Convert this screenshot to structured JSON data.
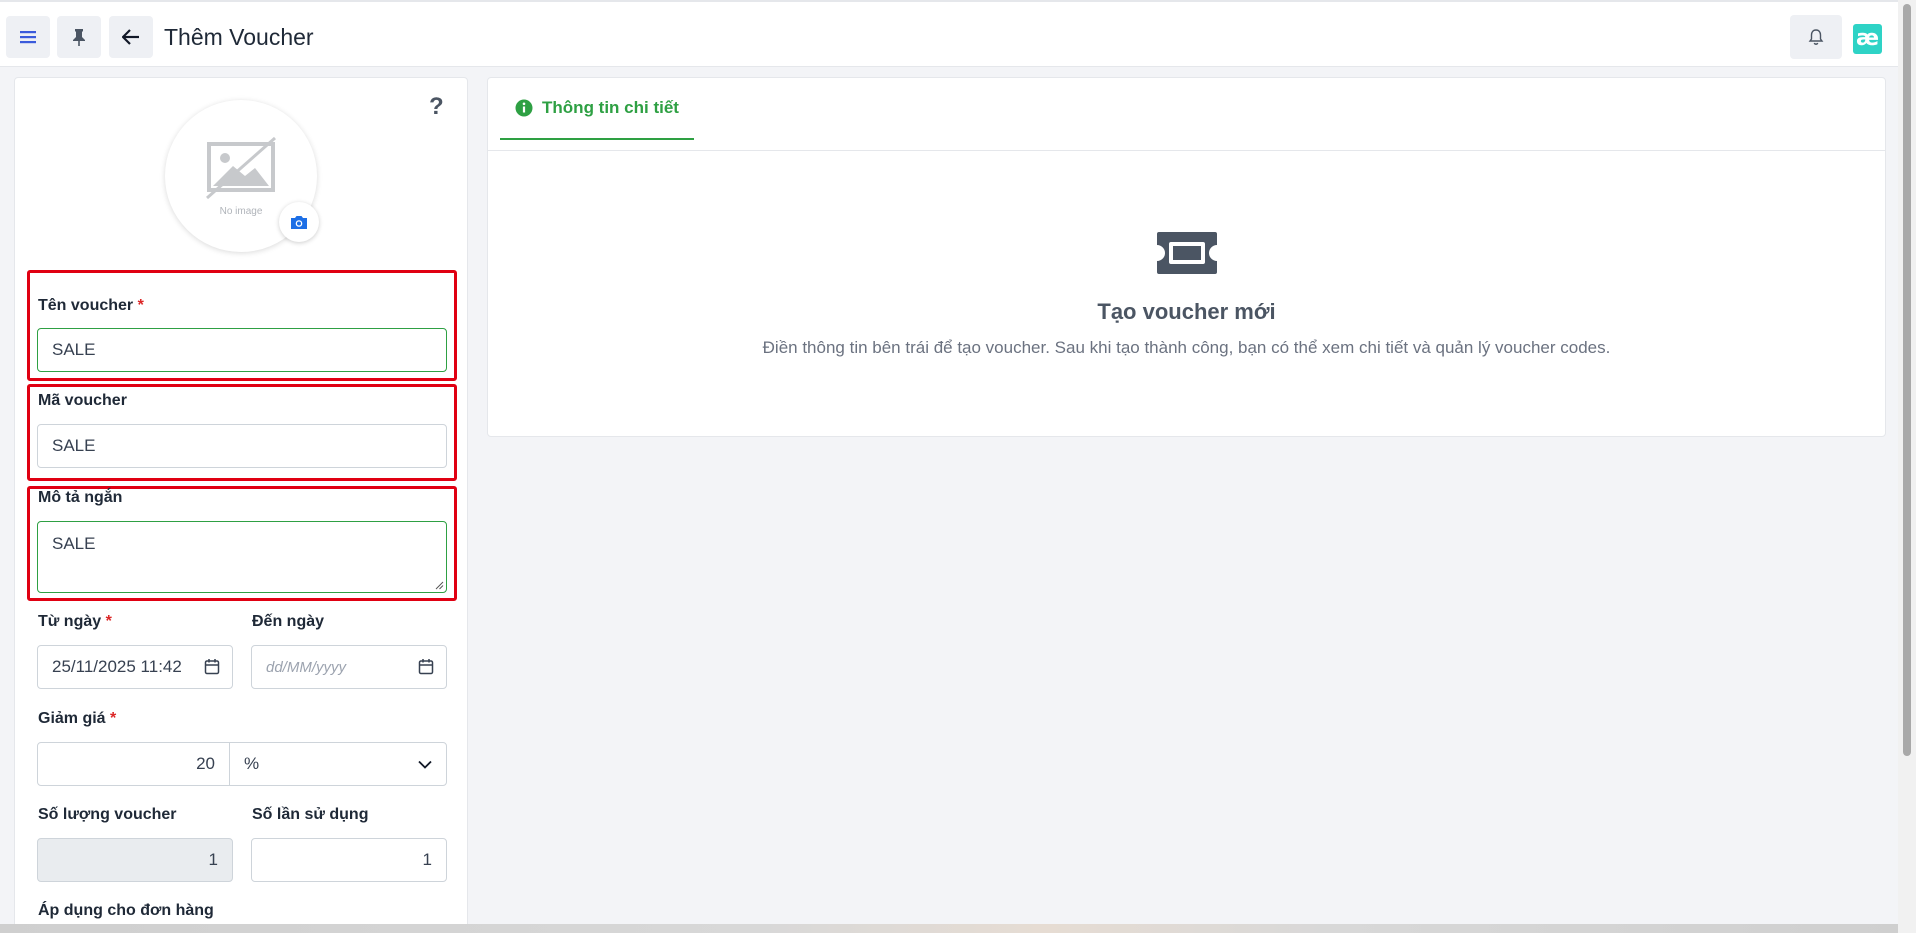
{
  "header": {
    "title": "Thêm Voucher",
    "icons": [
      "menu-icon",
      "pin-icon",
      "back-arrow-icon",
      "bell-icon"
    ],
    "logo_text": "æ"
  },
  "form": {
    "help_label": "?",
    "no_image_text": "No image",
    "name": {
      "label": "Tên voucher",
      "required_mark": "*",
      "value": "SALE"
    },
    "code": {
      "label": "Mã voucher",
      "value": "SALE"
    },
    "description": {
      "label": "Mô tả ngắn",
      "value": "SALE"
    },
    "from_date": {
      "label": "Từ ngày",
      "required_mark": "*",
      "value": "25/11/2025 11:42"
    },
    "to_date": {
      "label": "Đến ngày",
      "placeholder": "dd/MM/yyyy"
    },
    "discount": {
      "label": "Giảm giá",
      "required_mark": "*",
      "value": "20",
      "unit": "%"
    },
    "voucher_quantity": {
      "label": "Số lượng voucher",
      "value": "1"
    },
    "usage_count": {
      "label": "Số lần sử dụng",
      "value": "1"
    },
    "apply_for_order": {
      "label": "Áp dụng cho đơn hàng"
    }
  },
  "details": {
    "tab_label": "Thông tin chi tiết",
    "empty_title": "Tạo voucher mới",
    "empty_description": "Điền thông tin bên trái để tạo voucher. Sau khi tạo thành công, bạn có thể xem chi tiết và quản lý voucher codes."
  },
  "colors": {
    "accent_green": "#2ea043",
    "highlight_red": "#e00012",
    "required_red": "#dc2626",
    "logo_teal": "#2ed3c6"
  }
}
